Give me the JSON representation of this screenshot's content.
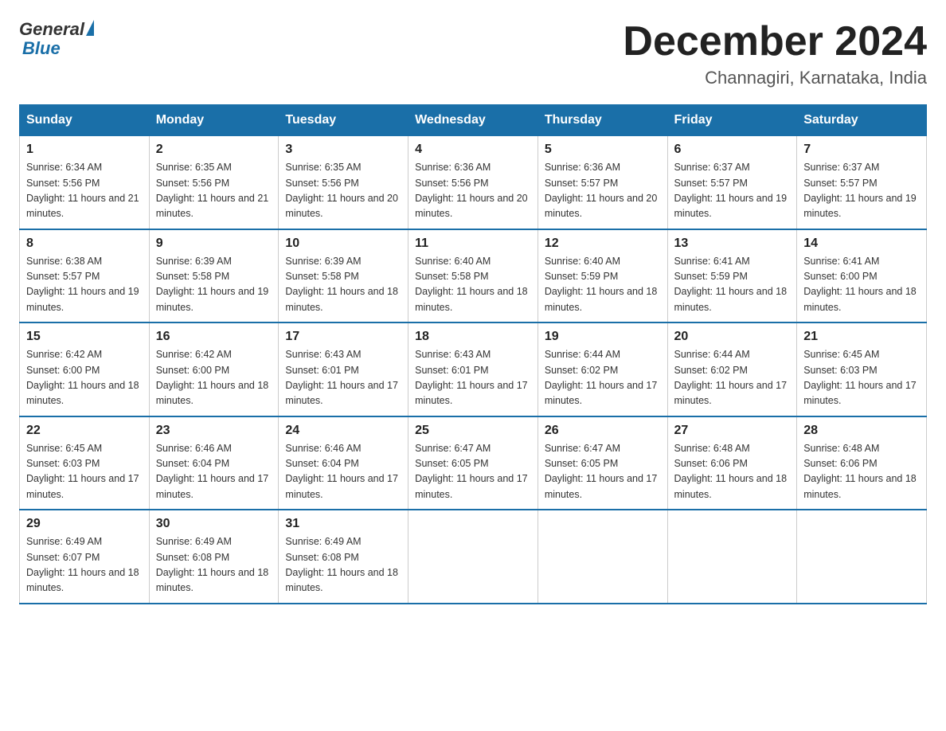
{
  "header": {
    "logo_general": "General",
    "logo_blue": "Blue",
    "month_year": "December 2024",
    "location": "Channagiri, Karnataka, India"
  },
  "weekdays": [
    "Sunday",
    "Monday",
    "Tuesday",
    "Wednesday",
    "Thursday",
    "Friday",
    "Saturday"
  ],
  "weeks": [
    [
      {
        "day": "1",
        "sunrise": "6:34 AM",
        "sunset": "5:56 PM",
        "daylight": "11 hours and 21 minutes."
      },
      {
        "day": "2",
        "sunrise": "6:35 AM",
        "sunset": "5:56 PM",
        "daylight": "11 hours and 21 minutes."
      },
      {
        "day": "3",
        "sunrise": "6:35 AM",
        "sunset": "5:56 PM",
        "daylight": "11 hours and 20 minutes."
      },
      {
        "day": "4",
        "sunrise": "6:36 AM",
        "sunset": "5:56 PM",
        "daylight": "11 hours and 20 minutes."
      },
      {
        "day": "5",
        "sunrise": "6:36 AM",
        "sunset": "5:57 PM",
        "daylight": "11 hours and 20 minutes."
      },
      {
        "day": "6",
        "sunrise": "6:37 AM",
        "sunset": "5:57 PM",
        "daylight": "11 hours and 19 minutes."
      },
      {
        "day": "7",
        "sunrise": "6:37 AM",
        "sunset": "5:57 PM",
        "daylight": "11 hours and 19 minutes."
      }
    ],
    [
      {
        "day": "8",
        "sunrise": "6:38 AM",
        "sunset": "5:57 PM",
        "daylight": "11 hours and 19 minutes."
      },
      {
        "day": "9",
        "sunrise": "6:39 AM",
        "sunset": "5:58 PM",
        "daylight": "11 hours and 19 minutes."
      },
      {
        "day": "10",
        "sunrise": "6:39 AM",
        "sunset": "5:58 PM",
        "daylight": "11 hours and 18 minutes."
      },
      {
        "day": "11",
        "sunrise": "6:40 AM",
        "sunset": "5:58 PM",
        "daylight": "11 hours and 18 minutes."
      },
      {
        "day": "12",
        "sunrise": "6:40 AM",
        "sunset": "5:59 PM",
        "daylight": "11 hours and 18 minutes."
      },
      {
        "day": "13",
        "sunrise": "6:41 AM",
        "sunset": "5:59 PM",
        "daylight": "11 hours and 18 minutes."
      },
      {
        "day": "14",
        "sunrise": "6:41 AM",
        "sunset": "6:00 PM",
        "daylight": "11 hours and 18 minutes."
      }
    ],
    [
      {
        "day": "15",
        "sunrise": "6:42 AM",
        "sunset": "6:00 PM",
        "daylight": "11 hours and 18 minutes."
      },
      {
        "day": "16",
        "sunrise": "6:42 AM",
        "sunset": "6:00 PM",
        "daylight": "11 hours and 18 minutes."
      },
      {
        "day": "17",
        "sunrise": "6:43 AM",
        "sunset": "6:01 PM",
        "daylight": "11 hours and 17 minutes."
      },
      {
        "day": "18",
        "sunrise": "6:43 AM",
        "sunset": "6:01 PM",
        "daylight": "11 hours and 17 minutes."
      },
      {
        "day": "19",
        "sunrise": "6:44 AM",
        "sunset": "6:02 PM",
        "daylight": "11 hours and 17 minutes."
      },
      {
        "day": "20",
        "sunrise": "6:44 AM",
        "sunset": "6:02 PM",
        "daylight": "11 hours and 17 minutes."
      },
      {
        "day": "21",
        "sunrise": "6:45 AM",
        "sunset": "6:03 PM",
        "daylight": "11 hours and 17 minutes."
      }
    ],
    [
      {
        "day": "22",
        "sunrise": "6:45 AM",
        "sunset": "6:03 PM",
        "daylight": "11 hours and 17 minutes."
      },
      {
        "day": "23",
        "sunrise": "6:46 AM",
        "sunset": "6:04 PM",
        "daylight": "11 hours and 17 minutes."
      },
      {
        "day": "24",
        "sunrise": "6:46 AM",
        "sunset": "6:04 PM",
        "daylight": "11 hours and 17 minutes."
      },
      {
        "day": "25",
        "sunrise": "6:47 AM",
        "sunset": "6:05 PM",
        "daylight": "11 hours and 17 minutes."
      },
      {
        "day": "26",
        "sunrise": "6:47 AM",
        "sunset": "6:05 PM",
        "daylight": "11 hours and 17 minutes."
      },
      {
        "day": "27",
        "sunrise": "6:48 AM",
        "sunset": "6:06 PM",
        "daylight": "11 hours and 18 minutes."
      },
      {
        "day": "28",
        "sunrise": "6:48 AM",
        "sunset": "6:06 PM",
        "daylight": "11 hours and 18 minutes."
      }
    ],
    [
      {
        "day": "29",
        "sunrise": "6:49 AM",
        "sunset": "6:07 PM",
        "daylight": "11 hours and 18 minutes."
      },
      {
        "day": "30",
        "sunrise": "6:49 AM",
        "sunset": "6:08 PM",
        "daylight": "11 hours and 18 minutes."
      },
      {
        "day": "31",
        "sunrise": "6:49 AM",
        "sunset": "6:08 PM",
        "daylight": "11 hours and 18 minutes."
      },
      null,
      null,
      null,
      null
    ]
  ]
}
